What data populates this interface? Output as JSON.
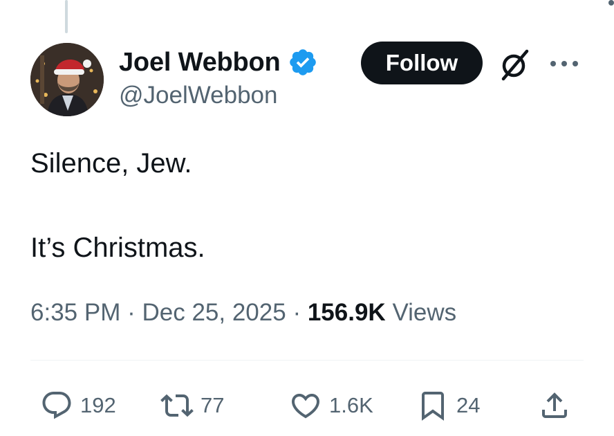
{
  "author": {
    "name": "Joel Webbon",
    "handle": "@JoelWebbon",
    "verified_icon": "verified-badge-icon",
    "verified_color": "#1d9bf0"
  },
  "header_actions": {
    "follow_label": "Follow",
    "grok_icon": "grok-icon",
    "more_icon": "more-icon"
  },
  "post": {
    "lines": [
      "Silence, Jew.",
      "It’s Christmas."
    ]
  },
  "meta": {
    "time": "6:35 PM",
    "separator": "·",
    "date": "Dec 25, 2025",
    "views_count": "156.9K",
    "views_label": "Views"
  },
  "actions": {
    "replies": "192",
    "reposts": "77",
    "likes": "1.6K",
    "bookmarks": "24"
  },
  "colors": {
    "text": "#0f1419",
    "secondary": "#536471",
    "accent": "#1d9bf0",
    "divider": "#eff3f4"
  }
}
